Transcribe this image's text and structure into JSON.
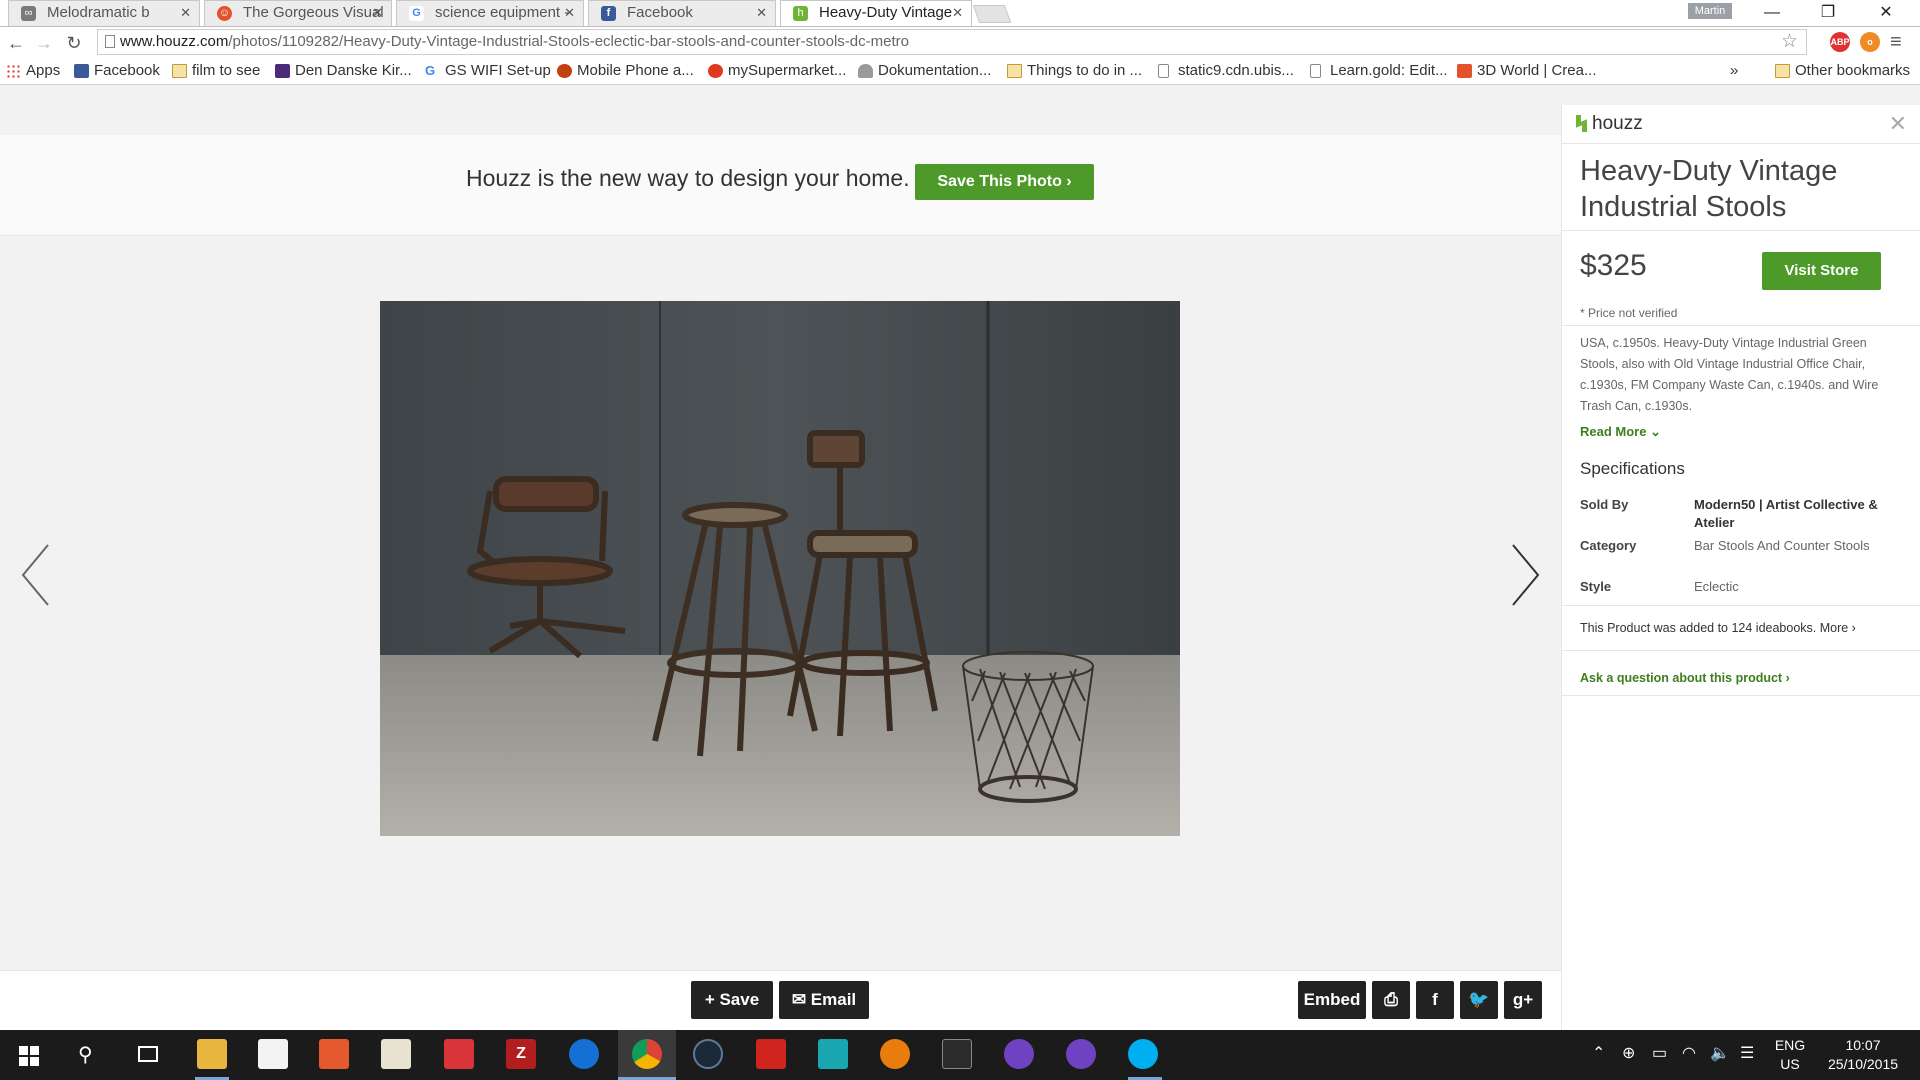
{
  "browser": {
    "tabs": [
      {
        "label": "Melodramatic b",
        "favicon": "link-icon",
        "extra": "sound-icon"
      },
      {
        "label": "The Gorgeous Visual",
        "favicon": "red-logo-icon"
      },
      {
        "label": "science equipment -",
        "favicon": "google-icon"
      },
      {
        "label": "Facebook",
        "favicon": "facebook-icon"
      },
      {
        "label": "Heavy-Duty Vintage",
        "favicon": "houzz-icon"
      }
    ],
    "profile_name": "Martin",
    "url_host": "www.houzz.com",
    "url_path": "/photos/1109282/Heavy-Duty-Vintage-Industrial-Stools-eclectic-bar-stools-and-counter-stools-dc-metro",
    "extensions": [
      "ABP",
      "o"
    ],
    "bookmarks": [
      {
        "label": "Apps",
        "icon": "apps-grid-icon"
      },
      {
        "label": "Facebook",
        "icon": "facebook-icon"
      },
      {
        "label": "film to see",
        "icon": "folder-icon"
      },
      {
        "label": "Den Danske Kir...",
        "icon": "church-icon"
      },
      {
        "label": "GS WIFI Set-up",
        "icon": "google-icon"
      },
      {
        "label": "Mobile Phone a...",
        "icon": "shield-icon"
      },
      {
        "label": "mySupermarket...",
        "icon": "tomato-icon"
      },
      {
        "label": "Dokumentation...",
        "icon": "hat-icon"
      },
      {
        "label": "Things to do in ...",
        "icon": "folder-icon"
      },
      {
        "label": "static9.cdn.ubis...",
        "icon": "page-icon"
      },
      {
        "label": "Learn.gold: Edit...",
        "icon": "page-icon"
      },
      {
        "label": "3D World | Crea...",
        "icon": "3dworld-icon"
      }
    ],
    "bookmarks_overflow": "»",
    "other_bookmarks": "Other bookmarks"
  },
  "page": {
    "banner_text": "Houzz is the new way to design your home.",
    "save_photo_label": "Save This Photo ›",
    "bottom": {
      "save_label": "+ Save",
      "email_label": "✉ Email",
      "embed_label": "Embed",
      "print_icon": "print-icon",
      "facebook_icon": "facebook-icon",
      "twitter_icon": "twitter-icon",
      "gplus_icon": "google-plus-icon"
    }
  },
  "panel": {
    "brand": "houzz",
    "title": "Heavy-Duty Vintage Industrial Stools",
    "price": "$325",
    "visit_store": "Visit Store",
    "price_note": "* Price not verified",
    "description": "USA, c.1950s. Heavy-Duty Vintage Industrial Green Stools, also with Old Vintage Industrial Office Chair, c.1930s, FM Company Waste Can, c.1940s. and Wire Trash Can, c.1930s.",
    "read_more": "Read More ⌄",
    "spec_heading": "Specifications",
    "specs": [
      {
        "label": "Sold By",
        "value": "Modern50 | Artist Collective & Atelier"
      },
      {
        "label": "Category",
        "value": "Bar Stools And Counter Stools"
      },
      {
        "label": "Style",
        "value": "Eclectic"
      }
    ],
    "ideabooks": "This Product was added to 124 ideabooks. More ›",
    "ask": "Ask a question about this product ›"
  },
  "taskbar": {
    "apps": [
      "windows-start-icon",
      "search-icon",
      "task-view-icon",
      "file-explorer-icon",
      "store-icon",
      "pencil-app-icon",
      "calendar-app-icon",
      "red-app-icon",
      "filezilla-icon",
      "edge-icon",
      "chrome-icon",
      "steam-icon",
      "creative-cloud-icon",
      "maya-icon",
      "blender-icon",
      "unity-icon",
      "github-icon",
      "github-icon",
      "skype-icon"
    ],
    "lang_top": "ENG",
    "lang_bottom": "US",
    "time": "10:07",
    "date": "25/10/2015"
  }
}
